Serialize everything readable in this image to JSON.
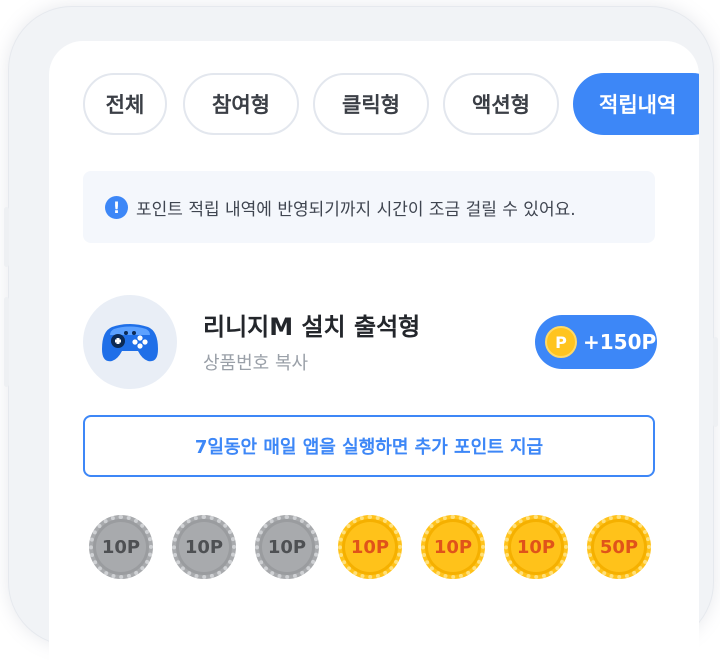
{
  "tabs": [
    {
      "label": "전체",
      "active": false
    },
    {
      "label": "참여형",
      "active": false
    },
    {
      "label": "클릭형",
      "active": false
    },
    {
      "label": "액션형",
      "active": false
    },
    {
      "label": "적립내역",
      "active": true
    }
  ],
  "notice": {
    "icon": "info-icon",
    "text": "포인트 적립 내역에 반영되기까지 시간이 조금 걸릴 수 있어요."
  },
  "item": {
    "icon": "gamepad-icon",
    "title": "리니지M 설치 출석형",
    "subtitle": "상품번호 복사",
    "point_symbol": "P",
    "points": "+150P"
  },
  "bonus_text": "7일동안 매일 앱을 실행하면 추가 포인트 지급",
  "daily_coins": [
    {
      "label": "10P",
      "status": "collected"
    },
    {
      "label": "10P",
      "status": "collected"
    },
    {
      "label": "10P",
      "status": "collected"
    },
    {
      "label": "10P",
      "status": "pending"
    },
    {
      "label": "10P",
      "status": "pending"
    },
    {
      "label": "10P",
      "status": "pending"
    },
    {
      "label": "50P",
      "status": "pending"
    }
  ],
  "colors": {
    "accent": "#3d87f7",
    "gold": "#ffc21a",
    "collected": "#a8aaad"
  }
}
